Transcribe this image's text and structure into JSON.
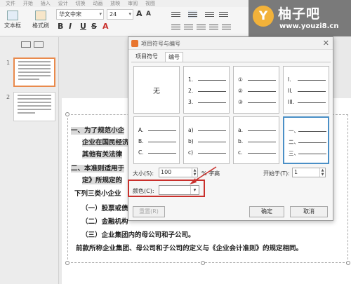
{
  "ribbon": {
    "top_tabs": [
      "文件",
      "开始",
      "插入",
      "设计",
      "切换",
      "动画",
      "放映",
      "审阅",
      "视图"
    ],
    "textbox_label": "文本框",
    "format_painter_label": "格式刷",
    "font_name": "华文中宋",
    "font_size": "24",
    "format_bold": "B",
    "format_italic": "I",
    "format_underline": "U",
    "format_strike": "S",
    "font_color_a": "A"
  },
  "logo": {
    "circle_letter": "Y",
    "brand": "柚子吧",
    "url": "www.youzi8.cn"
  },
  "thumbnails": [
    {
      "num": "1"
    },
    {
      "num": "2"
    }
  ],
  "slide": {
    "lines": [
      "一、为了规范小企",
      "企业在国民经济",
      "其他有关法律",
      "二、本准则适用于",
      "定》所规定的",
      "下列三类小企业",
      "（一）股票或债",
      "（二）金融机构",
      "（三）企业集团内的母公司和子公司。",
      "前款所称企业集团、母公司和子公司的定义与《企业会计准则》的规定相同。"
    ]
  },
  "dialog": {
    "title": "项目符号与编号",
    "close": "✕",
    "tabs": [
      "项目符号",
      "编号"
    ],
    "none_label": "无",
    "cells": [
      [
        "1.",
        "2.",
        "3."
      ],
      [
        "①",
        "②",
        "③"
      ],
      [
        "I.",
        "II.",
        "III."
      ],
      [
        "A.",
        "B.",
        "C."
      ],
      [
        "a)",
        "b)",
        "c)"
      ],
      [
        "a.",
        "b.",
        "c."
      ],
      [
        "一、",
        "二、",
        "三、"
      ]
    ],
    "size_label": "大小(S):",
    "size_value": "100",
    "size_unit": "% 字高",
    "start_label": "开始于(T):",
    "start_value": "1",
    "color_label": "颜色(C):",
    "reset_button": "重置(R)",
    "ok_button": "确定",
    "cancel_button": "取消"
  },
  "colors": {
    "accent_highlight": "#c9302c",
    "selection_blue": "#4a8fc6",
    "thumb_selected": "#e98a4c",
    "logo_orange": "#f2b23a"
  }
}
